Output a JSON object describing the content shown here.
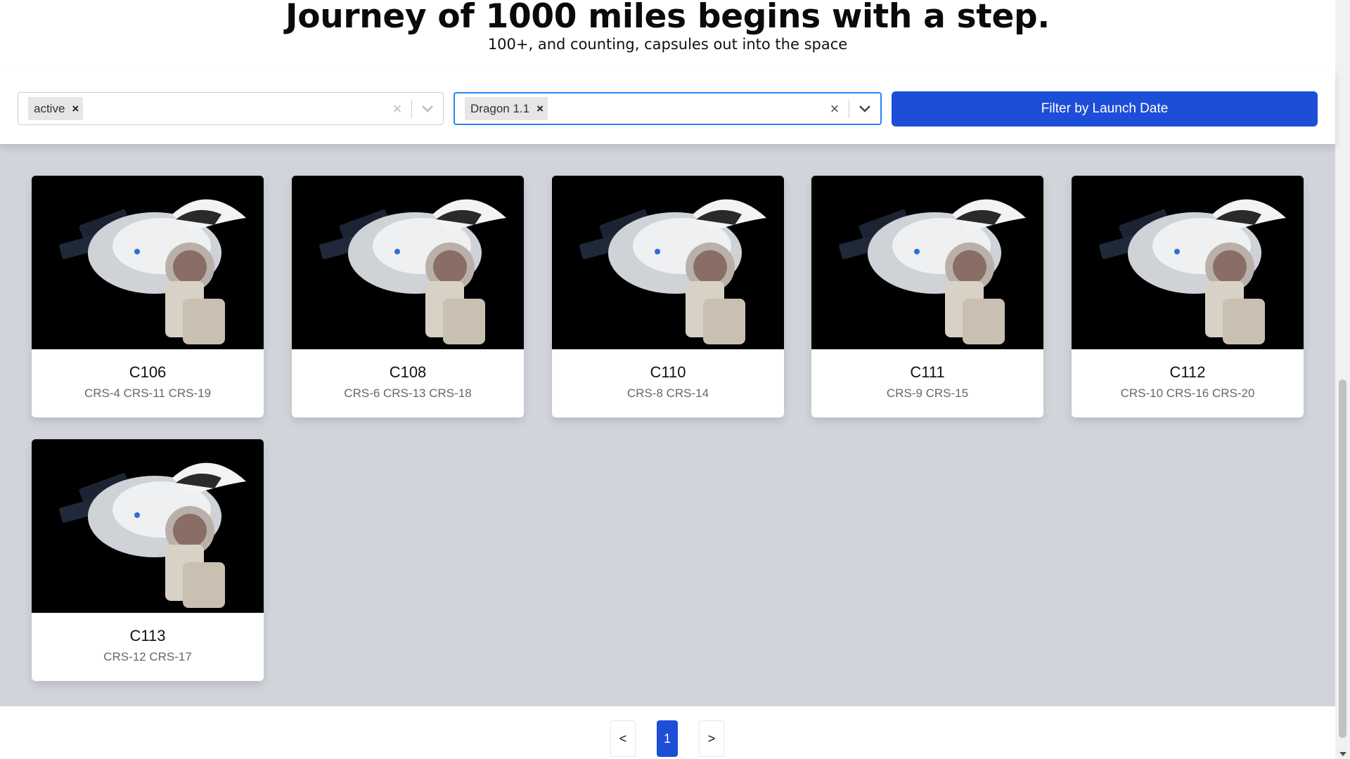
{
  "hero": {
    "title": "Journey of 1000 miles begins with a step.",
    "subtitle": "100+, and counting, capsules out into the space"
  },
  "filters": {
    "status_chip": "active",
    "type_chip": "Dragon 1.1",
    "chip_remove": "×",
    "clear_symbol": "×",
    "button_label": "Filter by Launch Date"
  },
  "capsules": [
    {
      "serial": "C106",
      "missions": "CRS-4 CRS-11 CRS-19"
    },
    {
      "serial": "C108",
      "missions": "CRS-6 CRS-13 CRS-18"
    },
    {
      "serial": "C110",
      "missions": "CRS-8 CRS-14"
    },
    {
      "serial": "C111",
      "missions": "CRS-9 CRS-15"
    },
    {
      "serial": "C112",
      "missions": "CRS-10 CRS-16 CRS-20"
    },
    {
      "serial": "C113",
      "missions": "CRS-12 CRS-17"
    }
  ],
  "pagination": {
    "prev": "<",
    "current": "1",
    "next": ">"
  },
  "colors": {
    "primary": "#1d4ed8",
    "page_background": "#d1d5db",
    "focus_border": "#2684ff"
  },
  "icons": [
    "close-icon",
    "chevron-down-icon",
    "capsule-image"
  ]
}
